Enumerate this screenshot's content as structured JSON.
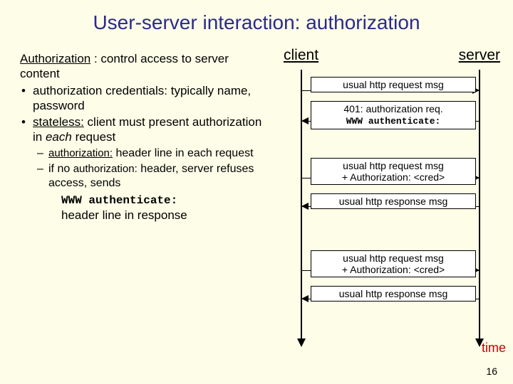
{
  "title": "User-server interaction: authorization",
  "left": {
    "intro_label": "Authorization",
    "intro_rest": " : control access to server content",
    "b1_a": "authorization credentials: typically name, password",
    "b2_a": "stateless:",
    "b2_b": " client must present authorization in ",
    "b2_c": "each",
    "b2_d": " request",
    "s1_a": "authorization:",
    "s1_b": " header line in each request",
    "s2_a": "if no ",
    "s2_b": "authorization:",
    "s2_c": " header, server refuses access, sends",
    "tail_code": "WWW authenticate:",
    "tail_rest": "header line in response"
  },
  "right": {
    "client": "client",
    "server": "server",
    "m1": "usual http request msg",
    "m2a": "401: authorization req.",
    "m2b": "WWW authenticate:",
    "m3a": "usual http request msg",
    "m3b": "+ Authorization: <cred>",
    "m4": "usual http response msg",
    "m5a": "usual http request msg",
    "m5b": "+ Authorization: <cred>",
    "m6": "usual http response msg",
    "time": "time"
  },
  "page": "16"
}
